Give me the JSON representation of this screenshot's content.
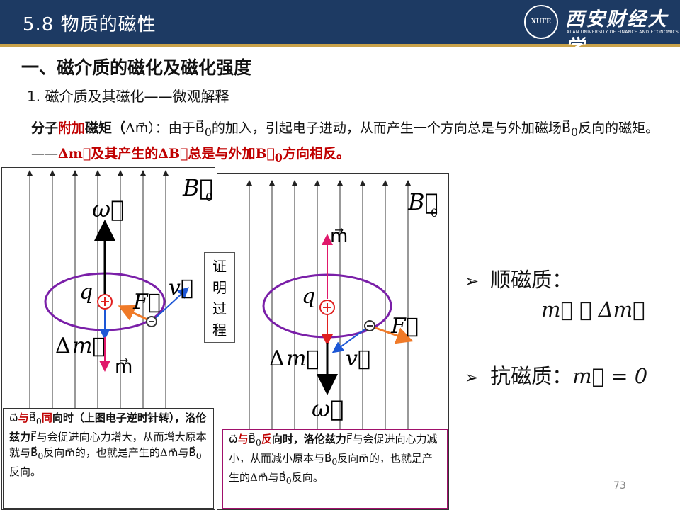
{
  "header": {
    "title": "5.8  物质的磁性",
    "logo_badge": "XUFE",
    "logo_cn": "西安财经大学",
    "logo_en": "XI'AN UNIVERSITY OF FINANCE AND ECONOMICS"
  },
  "heading1": "一、磁介质的磁化及磁化强度",
  "heading2": "1.   磁介质及其磁化——微观解释",
  "paragraph": {
    "lead_a": "分子",
    "lead_red": "附加",
    "lead_b": "磁矩（",
    "dm": "Δm⃗",
    "mid1": "）：由于",
    "b0a": "B⃗",
    "sub0": "0",
    "mid2": "的加入，引起电子进动，从而产生一个方向总是与外加磁场",
    "mid3": "反向的磁矩。——",
    "red_conclusion_a": "Δm⃗及其产生的ΔB⃗总是与外加",
    "red_conclusion_b": "方向相反。"
  },
  "proof_box": {
    "chars": [
      "证",
      "明",
      "过",
      "程"
    ]
  },
  "diagram_left": {
    "B0": "B⃗",
    "B0_sub": "0",
    "omega": "ω⃗",
    "q": "q",
    "F": "F⃗",
    "v": "v⃗",
    "dm_delta": "Δ",
    "dm_m": "m⃗",
    "m": "m⃗"
  },
  "diagram_right": {
    "B0": "B⃗",
    "B0_sub": "0",
    "m": "m⃗",
    "q": "q",
    "F": "F⃗",
    "v": "v⃗",
    "dm_delta": "Δ",
    "dm_m": "m⃗",
    "omega": "ω⃗"
  },
  "caption_left": {
    "omega": "ω⃗",
    "red1": "与",
    "b": "B⃗",
    "sub": "0",
    "red2": "同",
    "t1": "向时（上图电子逆时针转），洛伦兹力",
    "F": "F⃗",
    "t2": "与会促进向心力增大，从而增大原本就与",
    "t3": "反向",
    "m": "m⃗",
    "t4": "的，也就是产生的",
    "dm": "Δm⃗",
    "t5": "与",
    "t6": "反向。"
  },
  "caption_right": {
    "omega": "ω⃗",
    "red1": "与",
    "b": "B⃗",
    "sub": "0",
    "red2": "反",
    "t1": "向时，洛伦兹力",
    "F": "F⃗",
    "t2": "与会促进向心力减小，从而减小原本与",
    "t3": "反向",
    "m": "m⃗",
    "t4": "的，也就是产生的",
    "dm": "Δm⃗",
    "t5": "与",
    "t6": "反向。"
  },
  "right_list": {
    "item1_label": "顺磁质：",
    "item1_formula": "m⃗ ≫ Δm⃗",
    "item2_label": "抗磁质：",
    "item2_formula": "m⃗ = 0",
    "bullet": "➢"
  },
  "page_number": "73",
  "colors": {
    "header_bg": "#1d3a63",
    "accent_red": "#c00000",
    "magenta_arrow": "#e0186b",
    "orange_arrow": "#f07a28",
    "blue_arrow": "#1d57d6",
    "orbit": "#7a1fa8"
  }
}
